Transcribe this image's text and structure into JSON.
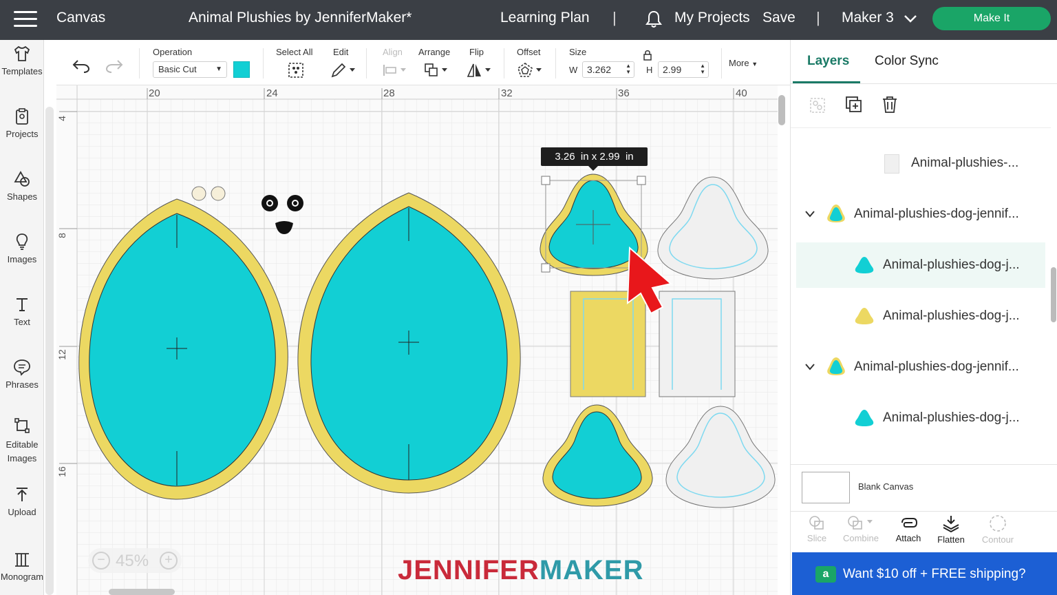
{
  "topbar": {
    "app": "Canvas",
    "project_title": "Animal Plushies by JenniferMaker*",
    "learning_plan": "Learning Plan",
    "separator": "|",
    "my_projects": "My Projects",
    "save": "Save",
    "machine": "Maker 3",
    "make_it": "Make It"
  },
  "sidebar": [
    {
      "label": "Templates",
      "icon": "tshirt-icon"
    },
    {
      "label": "Projects",
      "icon": "clipboard-icon"
    },
    {
      "label": "Shapes",
      "icon": "shapes-icon"
    },
    {
      "label": "Images",
      "icon": "lightbulb-icon"
    },
    {
      "label": "Text",
      "icon": "text-icon"
    },
    {
      "label": "Phrases",
      "icon": "speech-bubble-icon"
    },
    {
      "label": "Editable Images",
      "icon": "editable-image-icon"
    },
    {
      "label": "Upload",
      "icon": "upload-icon"
    },
    {
      "label": "Monogram",
      "icon": "monogram-icon"
    }
  ],
  "toolbar": {
    "operation_label": "Operation",
    "operation_value": "Basic Cut",
    "operation_color": "#12cfd4",
    "select_all": "Select All",
    "edit": "Edit",
    "align": "Align",
    "arrange": "Arrange",
    "flip": "Flip",
    "offset": "Offset",
    "size": "Size",
    "w_label": "W",
    "w_value": "3.262",
    "h_label": "H",
    "h_value": "2.99",
    "more": "More"
  },
  "canvas": {
    "ruler_top": [
      "20",
      "24",
      "28",
      "32",
      "36",
      "40"
    ],
    "ruler_left": [
      "4",
      "8",
      "12",
      "16"
    ],
    "size_tooltip": "3.26  in x 2.99  in",
    "zoom": "45%",
    "watermark_a": "JENNIFER",
    "watermark_b": "MAKER",
    "colors": {
      "teal": "#12cfd4",
      "yellow": "#ecd862",
      "grey": "#f0f0f0",
      "cursor": "#e8171b"
    }
  },
  "panel": {
    "tab_layers": "Layers",
    "tab_color_sync": "Color Sync",
    "layers": [
      {
        "label": "Animal-plushies-...",
        "type": "blank"
      },
      {
        "label": "Animal-plushies-dog-jennif...",
        "type": "group"
      },
      {
        "label": "Animal-plushies-dog-j...",
        "type": "teal",
        "selected": true
      },
      {
        "label": "Animal-plushies-dog-j...",
        "type": "yellow"
      },
      {
        "label": "Animal-plushies-dog-jennif...",
        "type": "group"
      },
      {
        "label": "Animal-plushies-dog-j...",
        "type": "teal"
      }
    ],
    "blank_canvas": "Blank Canvas",
    "tools": [
      {
        "label": "Slice",
        "enabled": false
      },
      {
        "label": "Combine",
        "enabled": false
      },
      {
        "label": "Attach",
        "enabled": true
      },
      {
        "label": "Flatten",
        "enabled": true
      },
      {
        "label": "Contour",
        "enabled": false
      }
    ],
    "promo": "Want $10 off + FREE shipping?"
  }
}
